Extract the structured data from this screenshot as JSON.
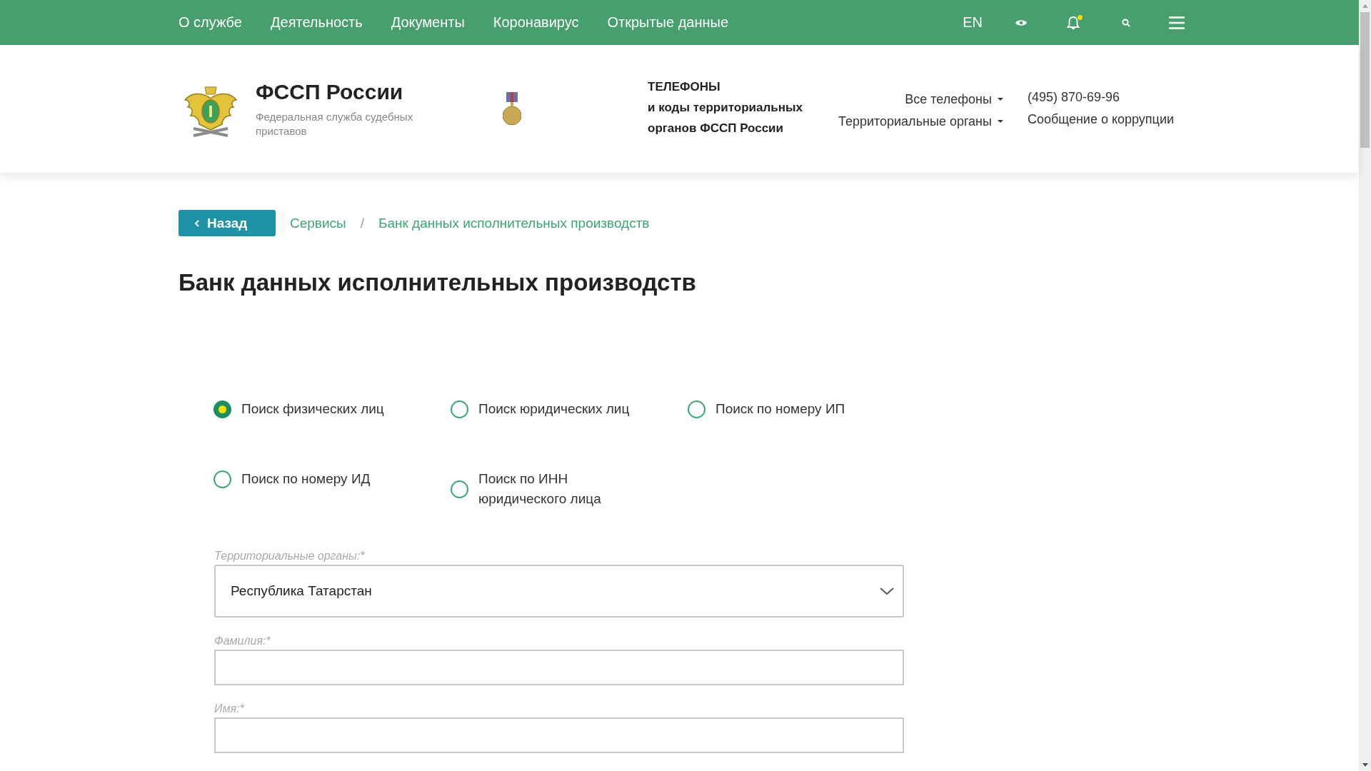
{
  "top_nav": {
    "items": [
      "О службе",
      "Деятельность",
      "Документы",
      "Коронавирус",
      "Открытые данные"
    ],
    "language": "EN",
    "has_notification": true
  },
  "header": {
    "title": "ФССП России",
    "subtitle": "Федеральная служба судебных приставов",
    "phones_block": [
      "ТЕЛЕФОНЫ",
      "и коды территориальных",
      "органов ФССП России"
    ],
    "dropdown_links": [
      "Все телефоны",
      "Территориальные органы"
    ],
    "contact_links": [
      "(495) 870-69-96",
      "Сообщение о коррупции"
    ]
  },
  "back_button": "Назад",
  "breadcrumbs": [
    "Сервисы",
    "Банк данных исполнительных производств"
  ],
  "breadcrumb_separator": "/",
  "page_title": "Банк данных исполнительных производств",
  "search_types": [
    {
      "label": "Поиск физических лиц",
      "selected": true
    },
    {
      "label": "Поиск юридических лиц",
      "selected": false
    },
    {
      "label": "Поиск по номеру ИП",
      "selected": false
    },
    {
      "label": "Поиск по номеру ИД",
      "selected": false
    },
    {
      "label": "Поиск по ИНН юридического лица",
      "selected": false
    }
  ],
  "form": {
    "fields": [
      {
        "kind": "select",
        "label": "Территориальные органы:*",
        "value": "Республика Татарстан"
      },
      {
        "kind": "text",
        "label": "Фамилия:*"
      },
      {
        "kind": "text",
        "label": "Имя:*"
      }
    ]
  }
}
